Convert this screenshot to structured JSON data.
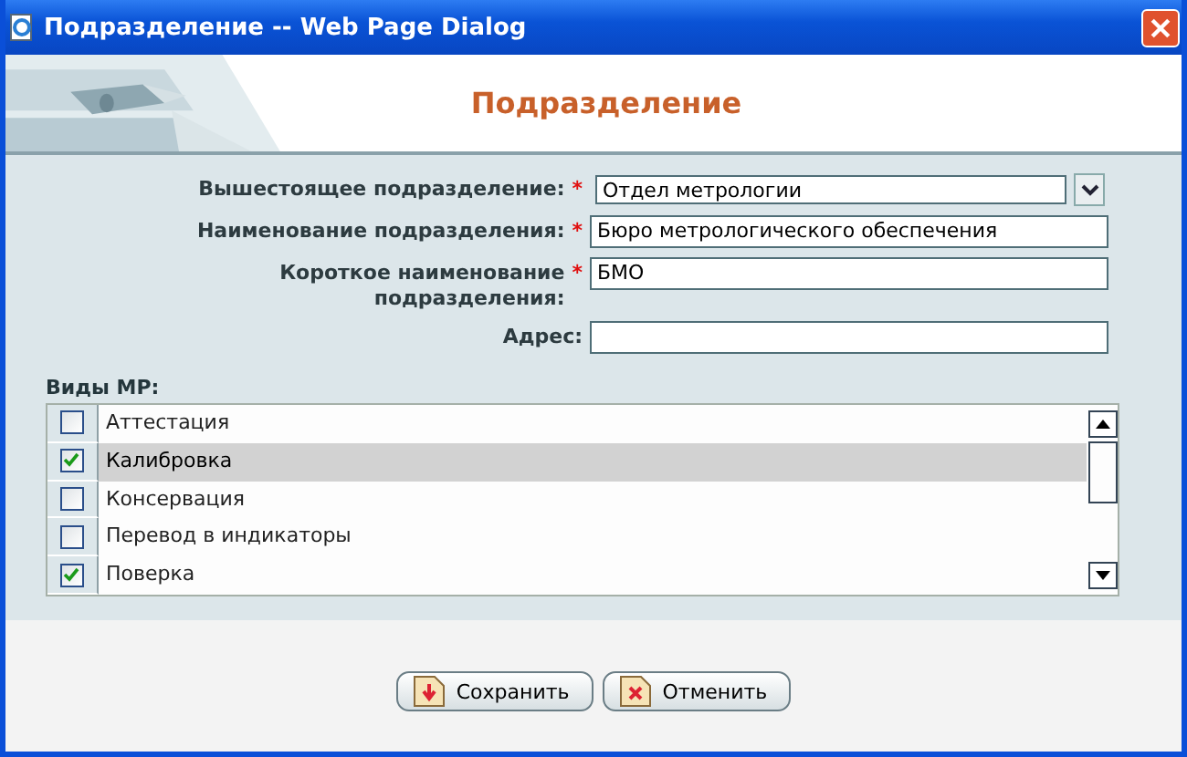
{
  "window": {
    "title": "Подразделение -- Web Page Dialog"
  },
  "header": {
    "title": "Подразделение"
  },
  "form": {
    "fields": [
      {
        "label": "Вышестоящее подразделение:",
        "required": "*",
        "value": "Отдел метрологии",
        "kind": "select"
      },
      {
        "label": "Наименование подразделения:",
        "required": "*",
        "value": "Бюро метрологического обеспечения",
        "kind": "text"
      },
      {
        "label": "Короткое наименование подразделения:",
        "required": "*",
        "value": "БМО",
        "kind": "text"
      },
      {
        "label": "Адрес:",
        "kind": "text"
      }
    ]
  },
  "types": {
    "label": "Виды МР:",
    "items": [
      {
        "name": "Аттестация",
        "checked": false,
        "selected": false
      },
      {
        "name": "Калибровка",
        "checked": true,
        "selected": true
      },
      {
        "name": "Консервация",
        "checked": false,
        "selected": false
      },
      {
        "name": "Перевод в индикаторы",
        "checked": false,
        "selected": false
      },
      {
        "name": "Поверка",
        "checked": true,
        "selected": false
      }
    ]
  },
  "buttons": [
    {
      "label": "Сохранить",
      "kind": "save"
    },
    {
      "label": "Отменить",
      "kind": "cancel"
    }
  ]
}
